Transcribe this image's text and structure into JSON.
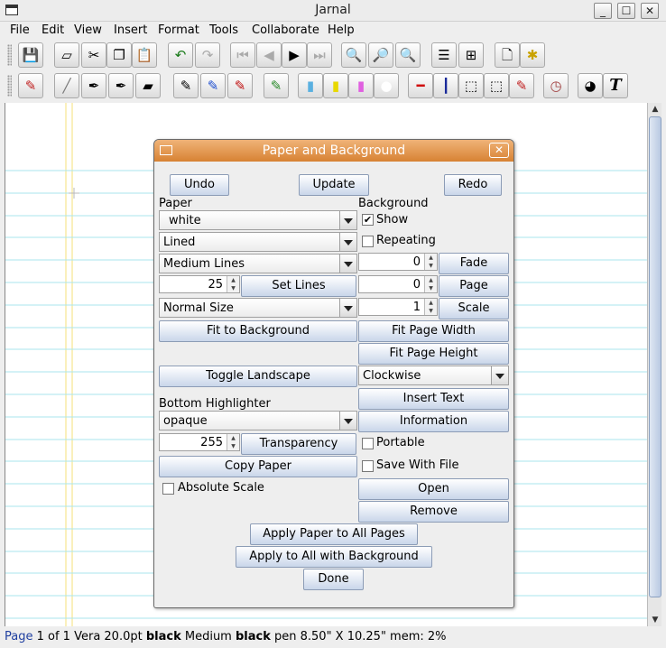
{
  "window": {
    "title": "Jarnal"
  },
  "menubar": [
    "File",
    "Edit",
    "View",
    "Insert",
    "Format",
    "Tools",
    "Collaborate",
    "Help"
  ],
  "toolbar_icons": {
    "row1": [
      "save-icon",
      "eraser-icon",
      "cut-icon",
      "copy-icon",
      "paste-icon",
      "undo-icon",
      "redo-icon",
      "first-page-icon",
      "previous-page-icon",
      "next-page-icon",
      "last-page-icon",
      "zoom-in-icon",
      "zoom-out-icon",
      "zoom-fit-icon",
      "single-page-view-icon",
      "multi-page-view-icon",
      "new-page-icon",
      "new-page-star-icon"
    ],
    "row2": [
      "pen-colors-icon",
      "pen-fine-icon",
      "pen-medium-icon",
      "pen-thick-icon",
      "pen-marker-icon",
      "black-pen-icon",
      "blue-pen-icon",
      "red-pen-icon",
      "pen-color-select-icon",
      "highlighter-blue-icon",
      "highlighter-yellow-icon",
      "highlighter-pink-icon",
      "white-icon",
      "red-line-icon",
      "blue-line-icon",
      "select-rect-icon",
      "select-region-icon",
      "eraser-pen-icon",
      "clock-icon",
      "fill-icon",
      "text-tool-icon"
    ]
  },
  "dialog": {
    "title": "Paper and Background",
    "buttons": {
      "undo": "Undo",
      "update": "Update",
      "redo": "Redo",
      "set_lines": "Set Lines",
      "fit_to_background": "Fit to Background",
      "toggle_landscape": "Toggle Landscape",
      "transparency": "Transparency",
      "copy_paper": "Copy Paper",
      "fade": "Fade",
      "page": "Page",
      "scale": "Scale",
      "fit_page_width": "Fit Page Width",
      "fit_page_height": "Fit Page Height",
      "insert_text": "Insert Text",
      "information": "Information",
      "open": "Open",
      "remove": "Remove",
      "apply_paper_all": "Apply Paper to All Pages",
      "apply_all_background": "Apply to All with Background",
      "done": "Done"
    },
    "labels": {
      "paper": "Paper",
      "background": "Background",
      "bottom_highlighter": "Bottom Highlighter"
    },
    "paper_color": "white",
    "paper_style": "Lined",
    "line_spacing": "Medium Lines",
    "lines_count": "25",
    "paper_size": "Normal Size",
    "highlighter_mode": "opaque",
    "transparency_value": "255",
    "fade_value": "0",
    "page_value": "0",
    "scale_value": "1",
    "rotation": "Clockwise",
    "checkboxes": {
      "show": {
        "label": "Show",
        "checked": true
      },
      "repeating": {
        "label": "Repeating",
        "checked": false
      },
      "portable": {
        "label": "Portable",
        "checked": false
      },
      "save_with_file": {
        "label": "Save With File",
        "checked": false
      },
      "absolute_scale": {
        "label": "Absolute Scale",
        "checked": false
      }
    }
  },
  "statusbar": {
    "page_label": "Page",
    "page_info": " 1 of 1 Vera 20.0pt ",
    "font_color": "black",
    "pen_prefix": "  Medium ",
    "pen_color": "black",
    "pen_suffix": " pen  8.50\" X 10.25\"   mem: 2%"
  },
  "colors": {
    "dialog_title": "#e08c3e",
    "paper_lines": "#a8e6ee",
    "margin_lines": "#f5e27a",
    "page_link": "#1f3fa0"
  }
}
